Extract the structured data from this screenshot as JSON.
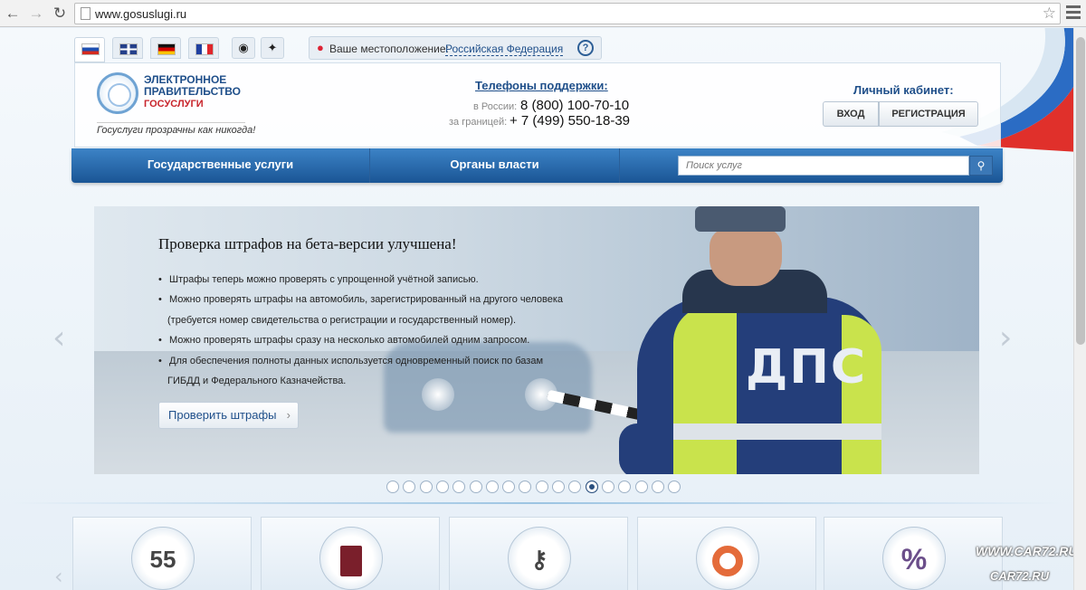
{
  "browser": {
    "url": "www.gosuslugi.ru"
  },
  "languages": [
    {
      "code": "ru",
      "colors": [
        "#ffffff",
        "#1f4fb0",
        "#d52b1e"
      ]
    },
    {
      "code": "en"
    },
    {
      "code": "de",
      "colors": [
        "#111111",
        "#d00000",
        "#f8c300"
      ]
    },
    {
      "code": "fr",
      "colors": [
        "#1f3fa0",
        "#ffffff",
        "#e0262b"
      ]
    }
  ],
  "location": {
    "label": "Ваше местоположение:",
    "value": "Российская Федерация",
    "help": "?"
  },
  "logo": {
    "line1": "ЭЛЕКТРОННОЕ",
    "line2": "ПРАВИТЕЛЬСТВО",
    "line3": "ГОСУСЛУГИ",
    "slogan": "Госуслуги прозрачны как никогда!"
  },
  "support": {
    "title": "Телефоны поддержки",
    "russia_label": "в России:",
    "russia_phone": "8 (800) 100-70-10",
    "abroad_label": "за границей:",
    "abroad_phone": "+ 7 (499) 550-18-39"
  },
  "cabinet": {
    "title": "Личный кабинет:",
    "login": "ВХОД",
    "register": "РЕГИСТРАЦИЯ"
  },
  "nav": {
    "services": "Государственные услуги",
    "authorities": "Органы власти",
    "search_placeholder": "Поиск услуг"
  },
  "slide": {
    "title": "Проверка штрафов на бета-версии улучшена!",
    "bullets": [
      "Штрафы теперь можно проверять с упрощенной учётной записью.",
      "Можно проверять штрафы на автомобиль, зарегистрированный на другого человека",
      "(требуется номер свидетельства о регистрации и государственный номер).",
      "Можно проверять штрафы сразу на несколько автомобилей одним запросом.",
      "Для обеспечения полноты данных используется одновременный поиск по базам",
      "ГИБДД и Федерального Казначейства."
    ],
    "button": "Проверить штрафы",
    "image_text": "ДПС"
  },
  "pagination": {
    "total": 18,
    "active": 13
  },
  "tiles": [
    {
      "icon": "calendar-icon",
      "text": "55"
    },
    {
      "icon": "passport-icon"
    },
    {
      "icon": "keys-icon"
    },
    {
      "icon": "lifebuoy-icon"
    },
    {
      "icon": "percent-icon",
      "text": "%"
    }
  ],
  "watermark": {
    "line1": "WWW.CAR72.RU",
    "line2": "CAR72.RU"
  }
}
